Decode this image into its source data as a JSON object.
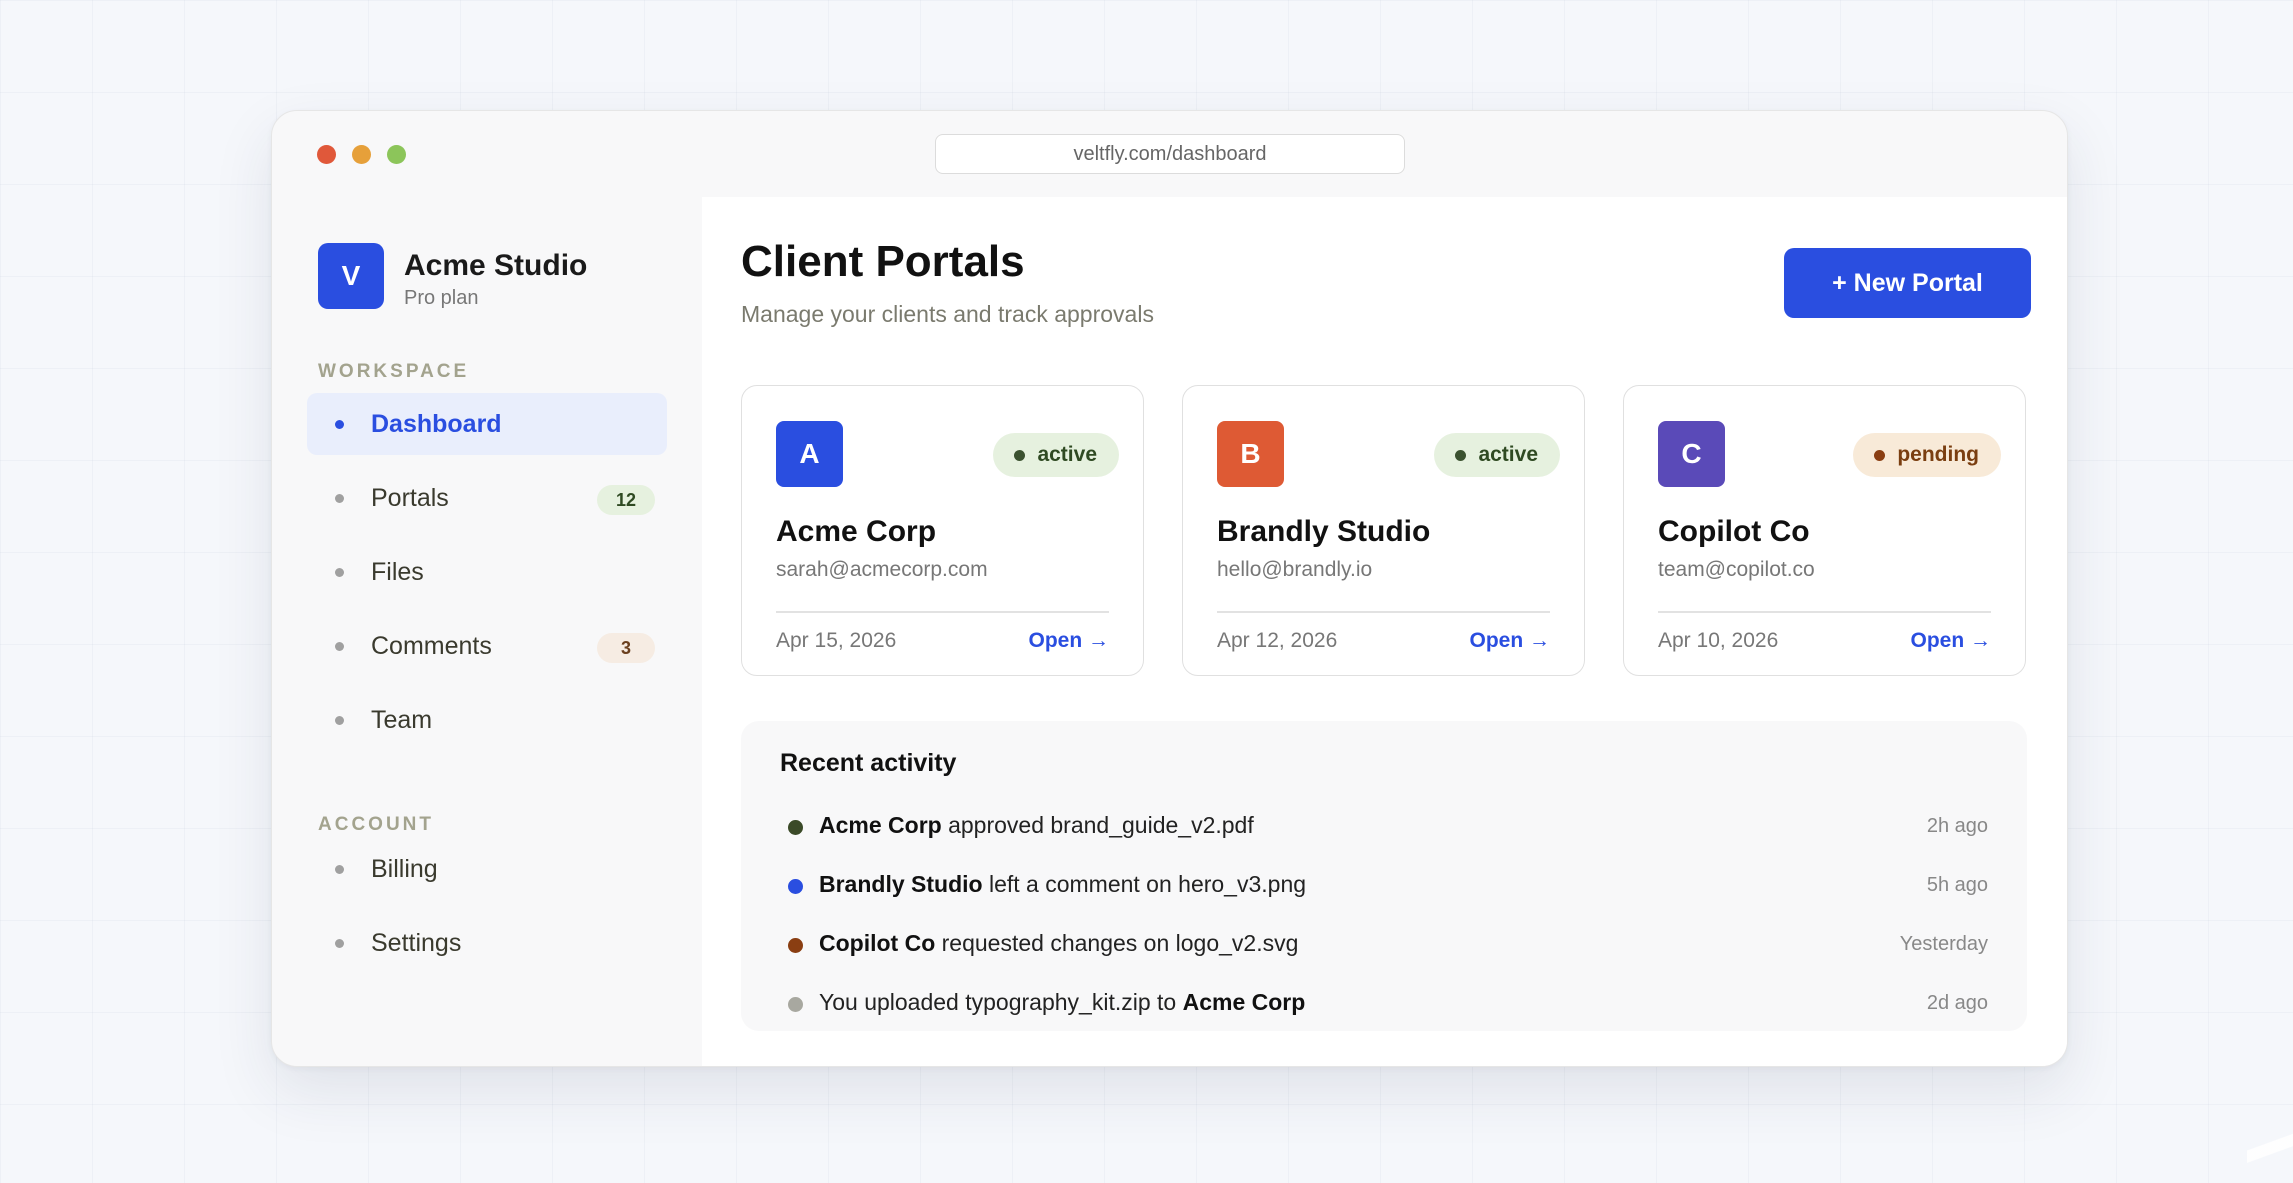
{
  "browser": {
    "url": "veltfly.com/dashboard"
  },
  "brand": {
    "initial": "V",
    "name": "Acme Studio",
    "plan": "Pro plan"
  },
  "sidebar": {
    "workspace_label": "WORKSPACE",
    "account_label": "ACCOUNT",
    "items": [
      {
        "label": "Dashboard",
        "active": true
      },
      {
        "label": "Portals",
        "badge": "12"
      },
      {
        "label": "Files"
      },
      {
        "label": "Comments",
        "badge": "3"
      },
      {
        "label": "Team"
      }
    ],
    "account_items": [
      {
        "label": "Billing"
      },
      {
        "label": "Settings"
      }
    ]
  },
  "header": {
    "title": "Client Portals",
    "subtitle": "Manage your clients and track approvals",
    "new_button": "+ New Portal"
  },
  "cards": [
    {
      "initial": "A",
      "color": "#2a4ee0",
      "status": "active",
      "name": "Acme Corp",
      "email": "sarah@acmecorp.com",
      "date": "Apr 15, 2026",
      "open": "Open →"
    },
    {
      "initial": "B",
      "color": "#de5a34",
      "status": "active",
      "name": "Brandly Studio",
      "email": "hello@brandly.io",
      "date": "Apr 12, 2026",
      "open": "Open →"
    },
    {
      "initial": "C",
      "color": "#5a4ab8",
      "status": "pending",
      "name": "Copilot Co",
      "email": "team@copilot.co",
      "date": "Apr 10, 2026",
      "open": "Open →"
    }
  ],
  "activity": {
    "title": "Recent activity",
    "items": [
      {
        "dot": "#3b4a28",
        "bold": "Acme Corp",
        "text": " approved brand_guide_v2.pdf",
        "time": "2h ago"
      },
      {
        "dot": "#2a4ee0",
        "bold": "Brandly Studio",
        "text": " left a comment on hero_v3.png",
        "time": "5h ago"
      },
      {
        "dot": "#8a3e12",
        "bold": "Copilot Co",
        "text": " requested changes on logo_v2.svg",
        "time": "Yesterday"
      },
      {
        "dot": "#a8a8a0",
        "pre": "You uploaded typography_kit.zip to ",
        "bold_end": "Acme Corp",
        "time": "2d ago"
      }
    ]
  },
  "colors": {
    "accent": "#2a4ee0",
    "active_badge": "#e6f1df",
    "pending_badge": "#f8ead8"
  }
}
